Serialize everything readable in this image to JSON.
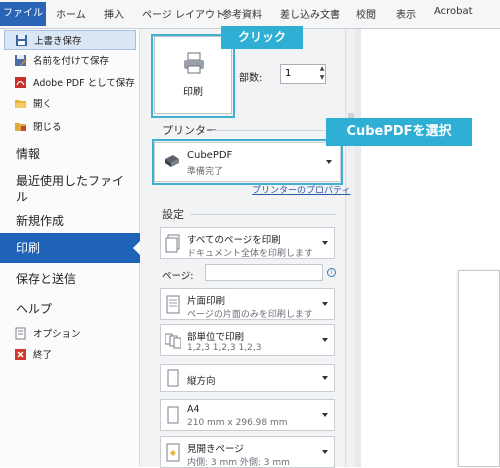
{
  "ribbon": {
    "tabs": [
      "ファイル",
      "ホーム",
      "挿入",
      "ページ レイアウト",
      "参考資料",
      "差し込み文書",
      "校閲",
      "表示",
      "Acrobat"
    ]
  },
  "nav": {
    "small_top": [
      {
        "label": "上書き保存",
        "icon": "save-icon"
      },
      {
        "label": "名前を付けて保存",
        "icon": "save-as-icon"
      },
      {
        "label": "Adobe PDF として保存",
        "icon": "pdf-icon"
      },
      {
        "label": "開く",
        "icon": "open-folder-icon"
      },
      {
        "label": "閉じる",
        "icon": "close-folder-icon"
      }
    ],
    "info": "情報",
    "recent_line1": "最近使用したファイ",
    "recent_line2": "ル",
    "new": "新規作成",
    "print": "印刷",
    "save_send": "保存と送信",
    "help": "ヘルプ",
    "options": "オプション",
    "exit": "終了"
  },
  "print_panel": {
    "print_button": "印刷",
    "copies_label": "部数:",
    "copies_value": "1",
    "printer_section": "プリンター",
    "printer_name": "CubePDF",
    "printer_status": "準備完了",
    "printer_properties": "プリンターのプロパティ",
    "settings_section": "設定",
    "pages_label": "ページ:",
    "settings": [
      {
        "title": "すべてのページを印刷",
        "subtitle": "ドキュメント全体を印刷します"
      },
      {
        "title": "片面印刷",
        "subtitle": "ページの片面のみを印刷します"
      },
      {
        "title": "部単位で印刷",
        "subtitle": "1,2,3    1,2,3    1,2,3"
      },
      {
        "title": "縦方向",
        "subtitle": ""
      },
      {
        "title": "A4",
        "subtitle": "210 mm x 296.98 mm"
      },
      {
        "title": "見開きページ",
        "subtitle": "内側: 3 mm    外側: 3 mm"
      }
    ]
  },
  "callouts": {
    "click": "クリック",
    "select_printer": "CubePDFを選択"
  },
  "colors": {
    "file_tab": "#2a65b5",
    "print_selected": "#1f63b8",
    "callout": "#2eafd3"
  }
}
